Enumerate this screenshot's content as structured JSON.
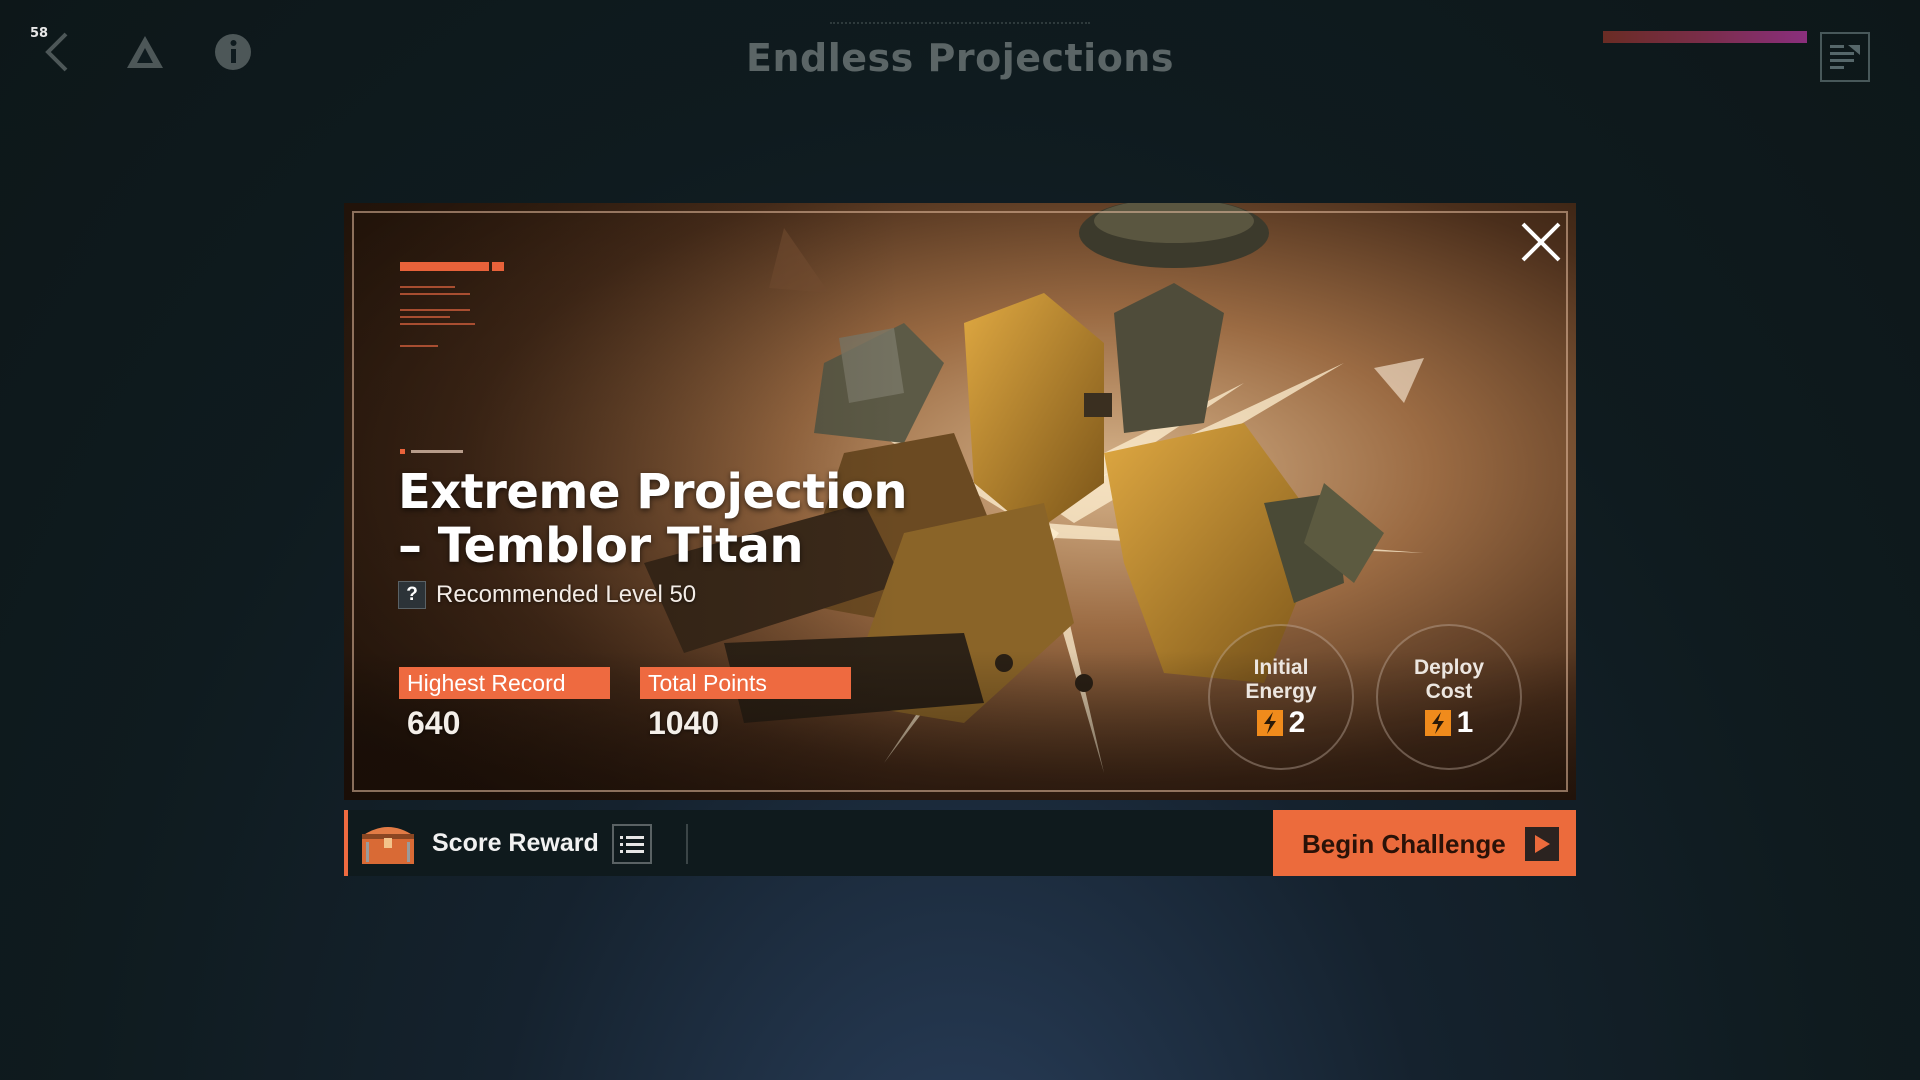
{
  "fps": "58",
  "header": {
    "title": "Endless Projections",
    "back_icon": "back-chevron-icon",
    "mode_icon": "triangle-logo-icon",
    "info_icon": "info-icon",
    "menu_icon": "document-list-icon"
  },
  "stage": {
    "title_line1": "Extreme Projection",
    "title_line2": "– Temblor Titan",
    "recommended_label": "Recommended Level 50",
    "help_glyph": "?"
  },
  "stats": {
    "highest_record_label": "Highest Record",
    "highest_record_value": "640",
    "total_points_label": "Total Points",
    "total_points_value": "1040"
  },
  "energy": {
    "initial_label_1": "Initial",
    "initial_label_2": "Energy",
    "initial_value": "2",
    "deploy_label_1": "Deploy",
    "deploy_label_2": "Cost",
    "deploy_value": "1"
  },
  "footer": {
    "score_reward_label": "Score Reward",
    "begin_label": "Begin Challenge"
  },
  "colors": {
    "accent": "#ee6a40",
    "bolt": "#f08b1c",
    "panel": "#0f1a1d"
  }
}
